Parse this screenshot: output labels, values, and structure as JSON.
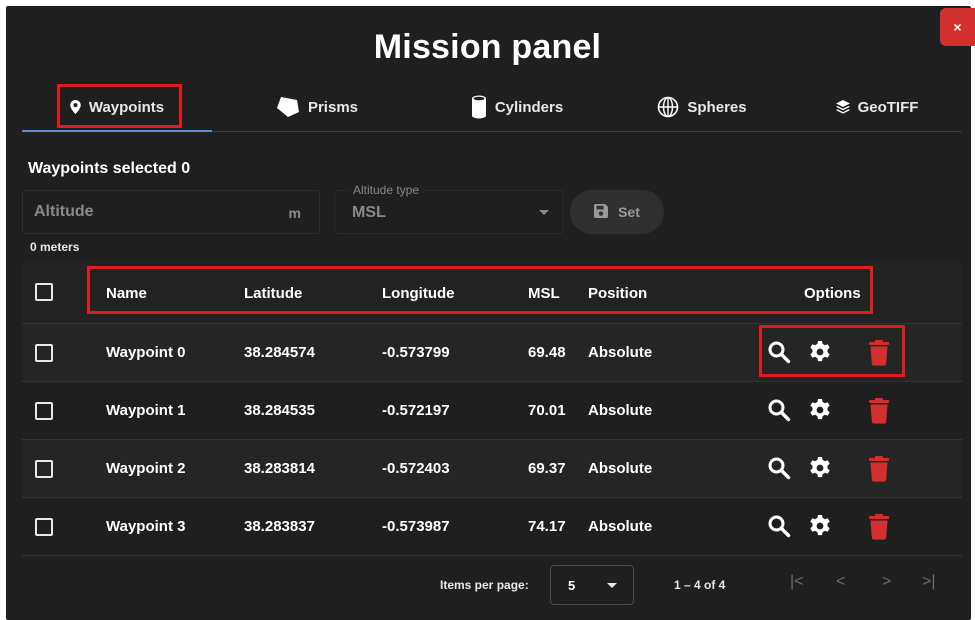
{
  "panel": {
    "title": "Mission panel",
    "close_label": "×"
  },
  "tabs": [
    {
      "label": "Waypoints",
      "icon": "map-marker-icon",
      "active": true
    },
    {
      "label": "Prisms",
      "icon": "pentagon-icon"
    },
    {
      "label": "Cylinders",
      "icon": "cylinder-icon"
    },
    {
      "label": "Spheres",
      "icon": "globe-icon"
    },
    {
      "label": "GeoTIFF",
      "icon": "layers-icon"
    }
  ],
  "selection": {
    "label": "Waypoints selected 0"
  },
  "altitude": {
    "placeholder": "Altitude",
    "unit": "m",
    "hint": "0 meters"
  },
  "altitude_type": {
    "label": "Altitude type",
    "value": "MSL"
  },
  "set_button": {
    "label": "Set"
  },
  "table": {
    "columns": [
      "Name",
      "Latitude",
      "Longitude",
      "MSL",
      "Position",
      "Options"
    ],
    "rows": [
      {
        "name": "Waypoint 0",
        "latitude": "38.284574",
        "longitude": "-0.573799",
        "msl": "69.48",
        "position": "Absolute"
      },
      {
        "name": "Waypoint 1",
        "latitude": "38.284535",
        "longitude": "-0.572197",
        "msl": "70.01",
        "position": "Absolute"
      },
      {
        "name": "Waypoint 2",
        "latitude": "38.283814",
        "longitude": "-0.572403",
        "msl": "69.37",
        "position": "Absolute"
      },
      {
        "name": "Waypoint 3",
        "latitude": "38.283837",
        "longitude": "-0.573987",
        "msl": "74.17",
        "position": "Absolute"
      }
    ]
  },
  "pagination": {
    "items_per_page_label": "Items per page:",
    "items_per_page": "5",
    "range": "1 – 4 of 4",
    "first": "|<",
    "prev": "<",
    "next": ">",
    "last": ">|"
  },
  "colors": {
    "background": "#1f1f1f",
    "accent": "#5a8bd6",
    "delete": "#d32f2f",
    "highlight": "#e11b22"
  }
}
